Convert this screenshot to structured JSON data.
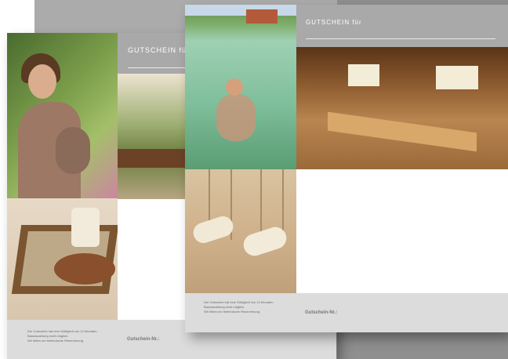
{
  "vouchers": {
    "back": {
      "title": "GUTSCHEIN für",
      "fine_print": [
        "Der Gutschein hat eine Gültigkeit von 12 Monaten.",
        "Barauszahlung nicht möglich.",
        "Wir bitten um telefonische Reservierung."
      ],
      "number_label": "Gutschein-Nr.:"
    },
    "front": {
      "title": "GUTSCHEIN für",
      "fine_print": [
        "Der Gutschein hat eine Gültigkeit von 12 Monaten.",
        "Barauszahlung nicht möglich.",
        "Wir bitten um telefonische Reservierung."
      ],
      "number_label": "Gutschein-Nr.:"
    }
  },
  "colors": {
    "band": "#a9a9a9",
    "footer": "#dcdcdc",
    "backdrop": "#ababab"
  }
}
